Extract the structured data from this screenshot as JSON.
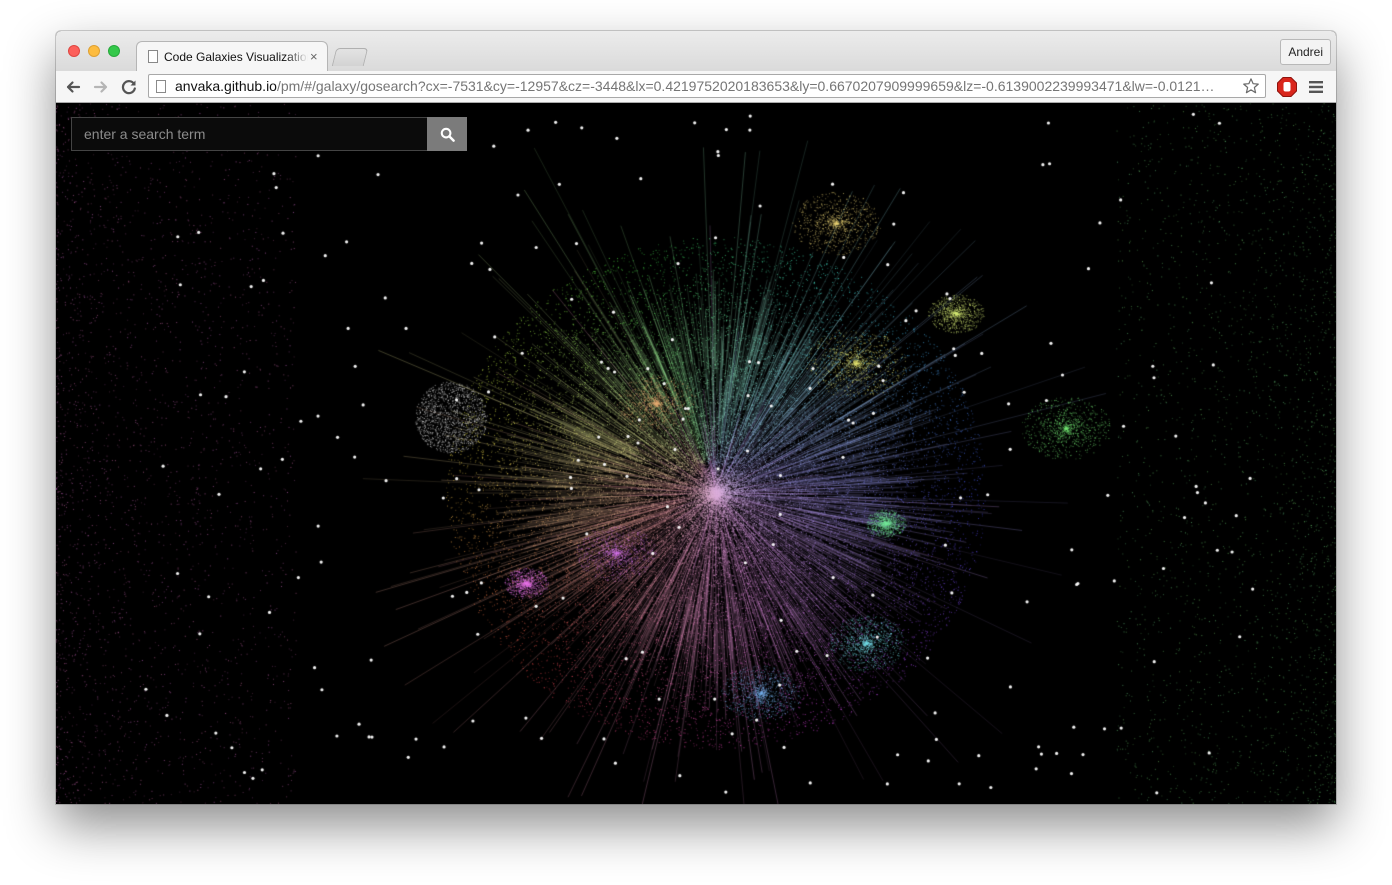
{
  "browser": {
    "tab_title": "Code Galaxies Visualization",
    "tab_close": "×",
    "profile_name": "Andrei",
    "url_host": "anvaka.github.io",
    "url_rest": "/pm/#/galaxy/gosearch?cx=-7531&cy=-12957&cz=-3448&lx=0.4219752020183653&ly=0.6670207909999659&lz=-0.6139002239993471&lw=-0.0121…",
    "icons": {
      "back": "back-arrow-icon",
      "forward": "forward-arrow-icon",
      "reload": "reload-icon",
      "bookmark": "star-icon",
      "extension": "adblock-icon",
      "menu": "hamburger-menu-icon"
    }
  },
  "search": {
    "placeholder": "enter a search term",
    "value": "",
    "button_icon": "search-icon"
  },
  "colors": {
    "background": "#000000",
    "search_button": "#7b7b7b",
    "traffic_red": "#fc605b",
    "traffic_yellow": "#fdbc40",
    "traffic_green": "#34c84a"
  }
}
